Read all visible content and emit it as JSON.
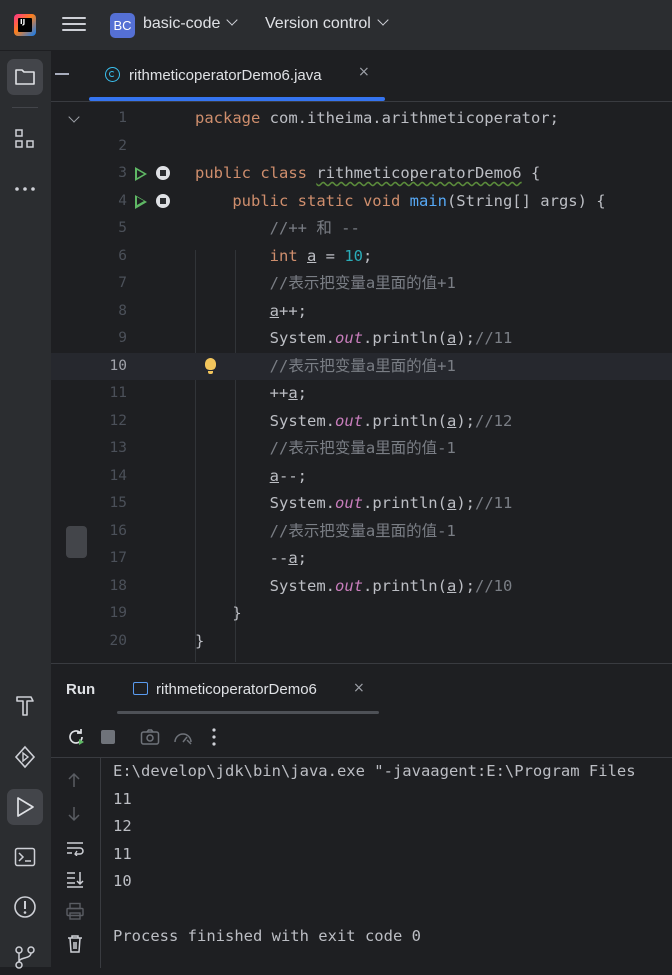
{
  "titlebar": {
    "logo": "IJ",
    "project_badge": "BC",
    "project_name": "basic-code",
    "vcs_label": "Version control"
  },
  "editor": {
    "tab_label": "rithmeticoperatorDemo6.java",
    "tab_close": "×",
    "current_line": 10,
    "lines": [
      {
        "n": "1",
        "tokens": [
          [
            "kw",
            "package "
          ],
          [
            "t",
            "com.itheima.arithmeticoperator;"
          ]
        ]
      },
      {
        "n": "2",
        "tokens": []
      },
      {
        "n": "3",
        "tokens": [
          [
            "kw",
            "public class "
          ],
          [
            "wavy",
            "rithmeticoperatorDemo6"
          ],
          [
            "t",
            " {"
          ]
        ]
      },
      {
        "n": "4",
        "tokens": [
          [
            "t",
            "    "
          ],
          [
            "kw",
            "public static void "
          ],
          [
            "fn",
            "main"
          ],
          [
            "t",
            "(String[] args) {"
          ]
        ]
      },
      {
        "n": "5",
        "tokens": [
          [
            "t",
            "        "
          ],
          [
            "cmt",
            "//++ 和 --"
          ]
        ]
      },
      {
        "n": "6",
        "tokens": [
          [
            "t",
            "        "
          ],
          [
            "kw",
            "int "
          ],
          [
            "ul",
            "a"
          ],
          [
            "t",
            " = "
          ],
          [
            "num",
            "10"
          ],
          [
            "t",
            ";"
          ]
        ]
      },
      {
        "n": "7",
        "tokens": [
          [
            "t",
            "        "
          ],
          [
            "cmt",
            "//表示把变量a里面的值+1"
          ]
        ]
      },
      {
        "n": "8",
        "tokens": [
          [
            "t",
            "        "
          ],
          [
            "ul",
            "a"
          ],
          [
            "t",
            "++;"
          ]
        ]
      },
      {
        "n": "9",
        "tokens": [
          [
            "t",
            "        System."
          ],
          [
            "it",
            "out"
          ],
          [
            "t",
            ".println("
          ],
          [
            "ul",
            "a"
          ],
          [
            "t",
            ");"
          ],
          [
            "cmt",
            "//11"
          ]
        ]
      },
      {
        "n": "10",
        "tokens": [
          [
            "t",
            "        "
          ],
          [
            "cmt",
            "//表示把变量a里面的值+1"
          ]
        ]
      },
      {
        "n": "11",
        "tokens": [
          [
            "t",
            "        ++"
          ],
          [
            "ul",
            "a"
          ],
          [
            "t",
            ";"
          ]
        ]
      },
      {
        "n": "12",
        "tokens": [
          [
            "t",
            "        System."
          ],
          [
            "it",
            "out"
          ],
          [
            "t",
            ".println("
          ],
          [
            "ul",
            "a"
          ],
          [
            "t",
            ");"
          ],
          [
            "cmt",
            "//12"
          ]
        ]
      },
      {
        "n": "13",
        "tokens": [
          [
            "t",
            "        "
          ],
          [
            "cmt",
            "//表示把变量a里面的值-1"
          ]
        ]
      },
      {
        "n": "14",
        "tokens": [
          [
            "t",
            "        "
          ],
          [
            "ul",
            "a"
          ],
          [
            "t",
            "--;"
          ]
        ]
      },
      {
        "n": "15",
        "tokens": [
          [
            "t",
            "        System."
          ],
          [
            "it",
            "out"
          ],
          [
            "t",
            ".println("
          ],
          [
            "ul",
            "a"
          ],
          [
            "t",
            ");"
          ],
          [
            "cmt",
            "//11"
          ]
        ]
      },
      {
        "n": "16",
        "tokens": [
          [
            "t",
            "        "
          ],
          [
            "cmt",
            "//表示把变量a里面的值-1"
          ]
        ]
      },
      {
        "n": "17",
        "tokens": [
          [
            "t",
            "        --"
          ],
          [
            "ul",
            "a"
          ],
          [
            "t",
            ";"
          ]
        ]
      },
      {
        "n": "18",
        "tokens": [
          [
            "t",
            "        System."
          ],
          [
            "it",
            "out"
          ],
          [
            "t",
            ".println("
          ],
          [
            "ul",
            "a"
          ],
          [
            "t",
            ");"
          ],
          [
            "cmt",
            "//10"
          ]
        ]
      },
      {
        "n": "19",
        "tokens": [
          [
            "t",
            "    }"
          ]
        ]
      },
      {
        "n": "20",
        "tokens": [
          [
            "t",
            "}"
          ]
        ]
      }
    ],
    "run_gutter_lines": [
      3,
      4
    ],
    "bulb_line": 10
  },
  "run": {
    "title": "Run",
    "tab_label": "rithmeticoperatorDemo6",
    "tab_close": "×",
    "console_lines": [
      "E:\\develop\\jdk\\bin\\java.exe \"-javaagent:E:\\Program Files",
      "11",
      "12",
      "11",
      "10",
      "",
      "Process finished with exit code 0"
    ]
  },
  "colors": {
    "keyword": "#cf8e6d",
    "method": "#56a8f5",
    "number": "#2aacb8",
    "comment": "#7a7e85",
    "static_field": "#c77dbb",
    "accent": "#3574f0",
    "run_green": "#5fb865"
  }
}
